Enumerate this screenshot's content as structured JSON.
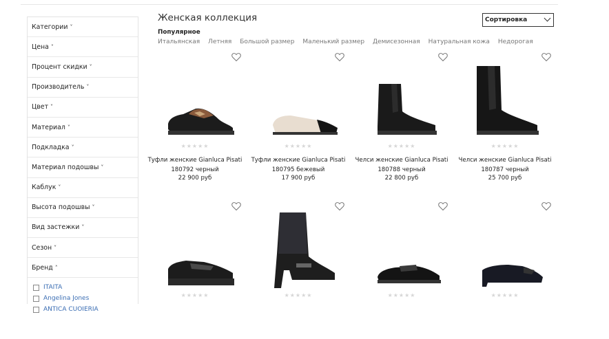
{
  "sidebar": {
    "filters": [
      {
        "label": "Категории"
      },
      {
        "label": "Цена"
      },
      {
        "label": "Процент скидки"
      },
      {
        "label": "Производитель"
      },
      {
        "label": "Цвет"
      },
      {
        "label": "Материал"
      },
      {
        "label": "Подкладка"
      },
      {
        "label": "Материал подошвы"
      },
      {
        "label": "Каблук"
      },
      {
        "label": "Высота подошвы"
      },
      {
        "label": "Вид застежки"
      },
      {
        "label": "Сезон"
      }
    ],
    "brand": {
      "label": "Бренд",
      "items": [
        "ITAITA",
        "Angelina Jones",
        "ANTICA CUOIERIA"
      ]
    },
    "chevron_down": "˅",
    "chevron_up": "˄"
  },
  "header": {
    "title": "Женская коллекция",
    "sort_label": "Сортировка",
    "popular_label": "Популярное",
    "tags": [
      "Итальянская",
      "Летняя",
      "Большой размер",
      "Маленький размер",
      "Демисезонная",
      "Натуральная кожа",
      "Недорогая"
    ]
  },
  "icons": {
    "heart": "heart-icon",
    "star": "star-icon"
  },
  "rating_stars": "★★★★★",
  "products": [
    {
      "name_line1": "Туфли женские Gianluca Pisati",
      "name_line2": "180792 черный",
      "price": "22 900 руб",
      "image": "loafer-leopard-chain"
    },
    {
      "name_line1": "Туфли женские Gianluca Pisati",
      "name_line2": "180795 бежевый",
      "price": "17 900 руб",
      "image": "ballet-flat-beige"
    },
    {
      "name_line1": "Челси женские Gianluca Pisati",
      "name_line2": "180788 черный",
      "price": "22 800 руб",
      "image": "chelsea-boot-black"
    },
    {
      "name_line1": "Челси женские Gianluca Pisati",
      "name_line2": "180787 черный",
      "price": "25 700 руб",
      "image": "chelsea-boot-high-black"
    },
    {
      "image": "loafer-platform-studded"
    },
    {
      "image": "ankle-boot-glitter-heel"
    },
    {
      "image": "loafer-patent-bow"
    },
    {
      "image": "pump-low-heel-black"
    }
  ]
}
